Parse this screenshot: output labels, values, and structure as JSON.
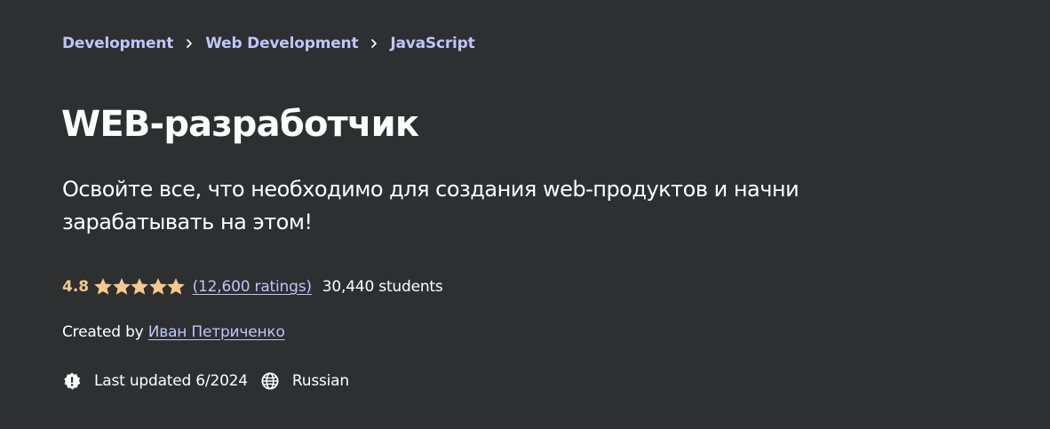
{
  "breadcrumb": [
    {
      "label": "Development"
    },
    {
      "label": "Web Development"
    },
    {
      "label": "JavaScript"
    }
  ],
  "course": {
    "title": "WEB-разработчик",
    "subtitle": "Освойте все, что необходимо для создания web-продуктов и начни зарабатывать на этом!"
  },
  "rating": {
    "value": "4.8",
    "stars_filled": 4.8,
    "stars_total": 5,
    "count_label": "(12,600 ratings)",
    "students": "30,440 students"
  },
  "creator": {
    "prefix": "Created by",
    "name": "Иван Петриченко"
  },
  "meta": {
    "last_updated": "Last updated 6/2024",
    "language": "Russian",
    "update_icon": "alert-badge-icon",
    "language_icon": "globe-icon"
  },
  "colors": {
    "background": "#2d2f31",
    "link": "#c0c4fc",
    "rating": "#f3ca8c",
    "text": "#ffffff"
  }
}
